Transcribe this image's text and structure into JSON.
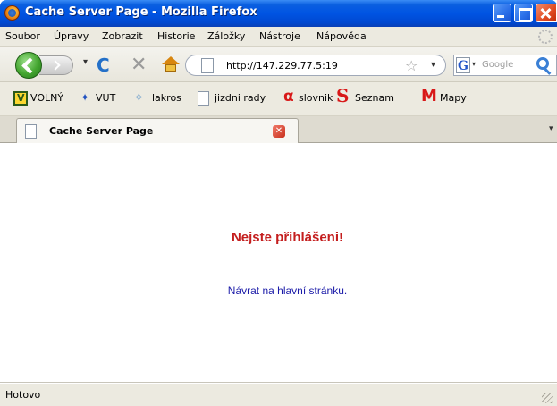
{
  "window": {
    "title": "Cache Server Page - Mozilla Firefox"
  },
  "menu": [
    {
      "label": "Soubor"
    },
    {
      "label": "Úpravy"
    },
    {
      "label": "Zobrazit"
    },
    {
      "label": "Historie"
    },
    {
      "label": "Záložky"
    },
    {
      "label": "Nástroje"
    },
    {
      "label": "Nápověda"
    }
  ],
  "nav": {
    "url": "http://147.229.77.5:19",
    "search_engine": "Google"
  },
  "bookmarks": [
    {
      "label": "VOLNÝ",
      "icon": "volny-icon"
    },
    {
      "label": "VUT",
      "icon": "vut-icon"
    },
    {
      "label": "lakros",
      "icon": "lakros-icon"
    },
    {
      "label": "jizdni rady",
      "icon": "page-icon"
    },
    {
      "label": "slovnik",
      "icon": "slovnik-icon"
    },
    {
      "label": "Seznam",
      "icon": "seznam-icon"
    },
    {
      "label": "Mapy",
      "icon": "mapy-icon"
    }
  ],
  "tabs": [
    {
      "label": "Cache Server Page"
    }
  ],
  "content": {
    "heading": "Nejste přihlášeni!",
    "back_link": "Návrat na hlavní stránku."
  },
  "status": {
    "text": "Hotovo"
  },
  "colors": {
    "heading": "#c41e1e",
    "link": "#1a1aa8",
    "titlebar": "#0054e3"
  }
}
